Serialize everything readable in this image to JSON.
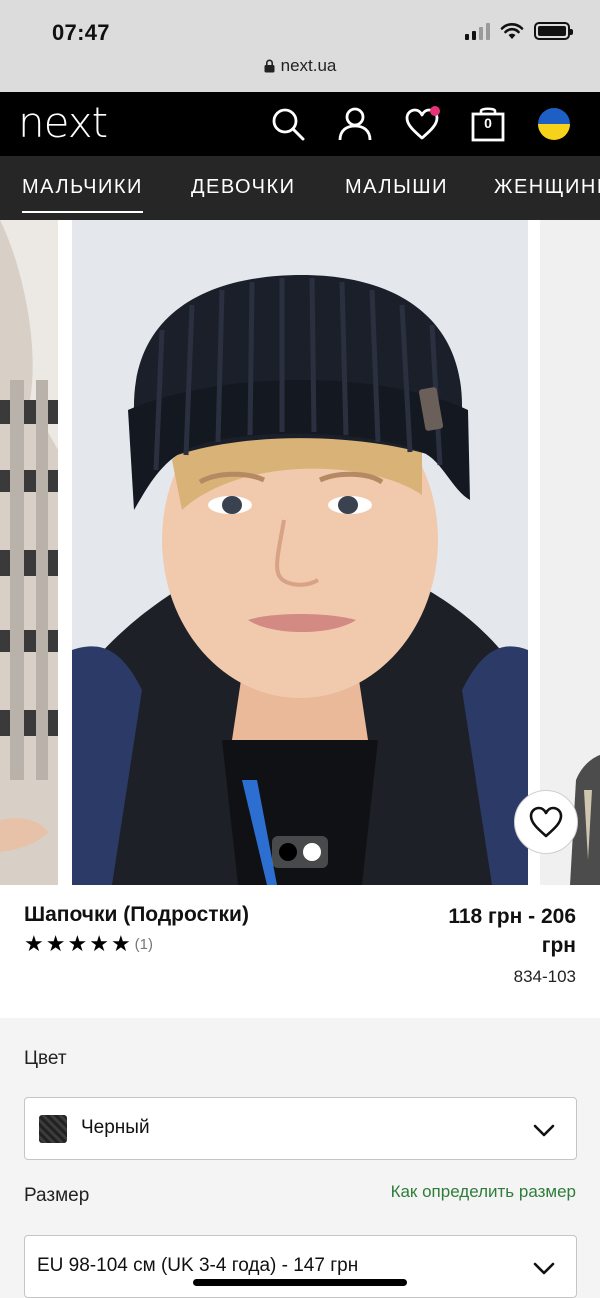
{
  "status_bar": {
    "time": "07:47",
    "url": "next.ua"
  },
  "header": {
    "logo": "next",
    "cart_count": "0",
    "icons": [
      "search-icon",
      "account-icon",
      "heart-icon",
      "shopping-bag-icon",
      "ukraine-flag-icon"
    ],
    "flag_colors": {
      "top": "#1e5fc6",
      "bottom": "#f7d21a"
    },
    "wishlist_dot_color": "#e8337a"
  },
  "nav": {
    "items": [
      {
        "label": "МАЛЬЧИКИ",
        "active": true
      },
      {
        "label": "ДЕВОЧКИ",
        "active": false
      },
      {
        "label": "МАЛЫШИ",
        "active": false
      },
      {
        "label": "ЖЕНЩИНЫ",
        "active": false
      }
    ]
  },
  "gallery": {
    "image_count": 2,
    "active_index": 0
  },
  "product": {
    "title": "Шапочки (Подростки)",
    "rating_stars": 5,
    "review_count": "(1)",
    "price_line1": "118 грн - 206",
    "price_line2": "грн",
    "code": "834-103"
  },
  "options": {
    "color_label": "Цвет",
    "color_value": "Черный",
    "size_label": "Размер",
    "size_guide_link": "Как определить размер",
    "size_value": "EU 98-104 см (UK 3-4 года) - 147 грн"
  },
  "colors": {
    "accent_link": "#2f7d3a",
    "header_bg": "#000000",
    "nav_bg": "#262626"
  }
}
